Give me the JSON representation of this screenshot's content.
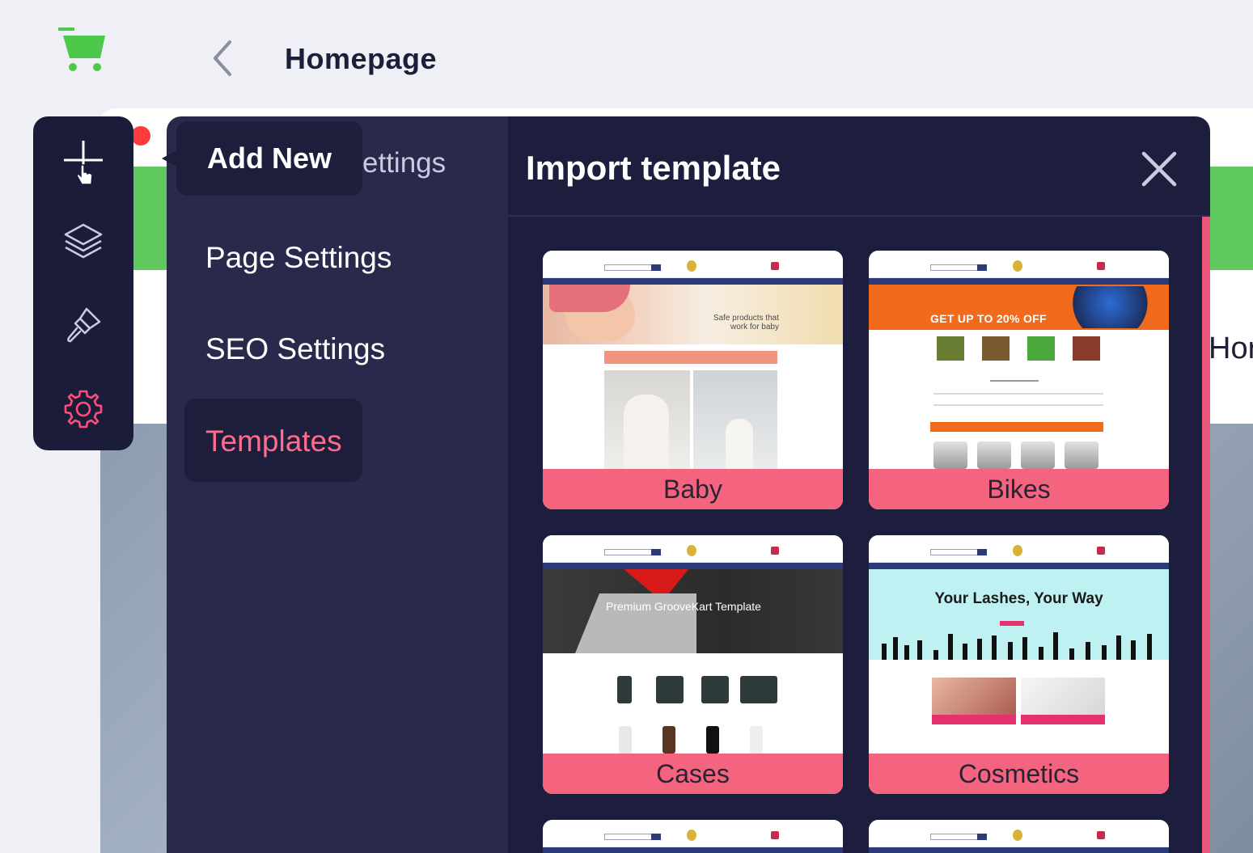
{
  "header": {
    "title": "Homepage"
  },
  "tooltip": {
    "label": "Add New"
  },
  "settings_panel": {
    "partial_label": "ettings",
    "items": [
      {
        "label": "Page Settings"
      },
      {
        "label": "SEO Settings"
      },
      {
        "label": "Templates"
      }
    ],
    "active_index": 2
  },
  "canvas": {
    "partial_text": "Hor"
  },
  "modal": {
    "title": "Import template",
    "templates": [
      {
        "name": "Baby",
        "thumb_text": "Safe products that work for baby"
      },
      {
        "name": "Bikes",
        "thumb_text": "GET UP TO 20% OFF"
      },
      {
        "name": "Cases",
        "thumb_text": "Premium GrooveKart Template"
      },
      {
        "name": "Cosmetics",
        "thumb_text": "Your Lashes, Your Way"
      }
    ]
  },
  "colors": {
    "rail_bg": "#1b1c3a",
    "panel_bg": "#28294b",
    "modal_bg": "#1d1e3d",
    "accent_pink": "#ff6b8d",
    "card_label_bg": "#f5647f",
    "logo_green": "#4cc84a"
  },
  "icons": [
    "cart-logo-icon",
    "chevron-left-icon",
    "plus-icon",
    "cursor-hand-icon",
    "layers-icon",
    "brush-icon",
    "gear-icon",
    "close-icon"
  ]
}
